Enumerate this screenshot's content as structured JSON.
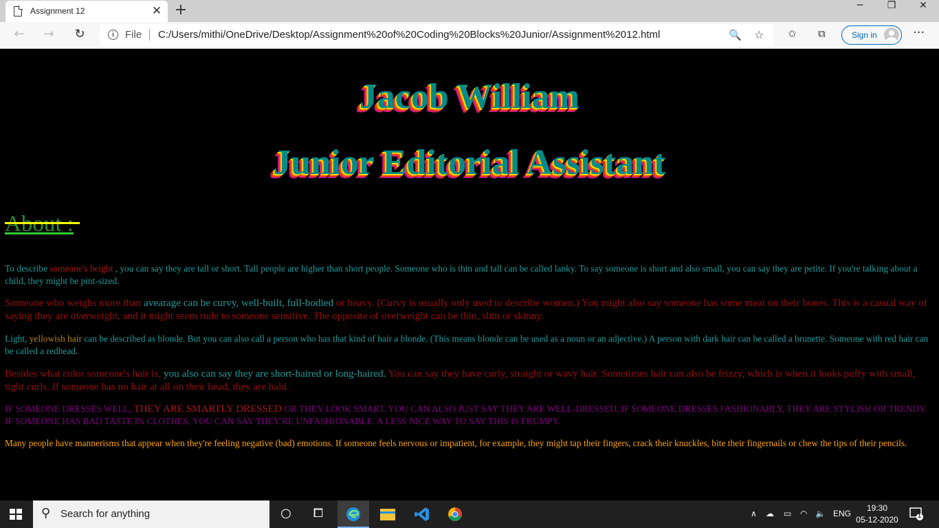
{
  "browser": {
    "tab_title": "Assignment 12",
    "tab_close": "✕",
    "new_tab": "+",
    "scheme_label": "File",
    "url": "C:/Users/mithi/OneDrive/Desktop/Assignment%20of%20Coding%20Blocks%20Junior/Assignment%2012.html",
    "sign_in": "Sign in",
    "more": "···"
  },
  "page": {
    "name_heading": "Jacob William",
    "role_heading": "Junior Editorial Assistant",
    "about_heading": "About :",
    "paragraphs": {
      "p1_a": "To describe ",
      "p1_hl": "someone's height",
      "p1_b": " , you can say they are tall or short. Tall people are higher than short people. Someone who is thin and tall can be called lanky. To say someone is short and also small, you can say they are petite. If you're talking about a child, they might be pint-sized.",
      "p2_a": "Someone who weighs more than ",
      "p2_hl": "avearage can be curvy, well-built, full-bodied",
      "p2_b": " or heavy. (Curvy is usually only used to describe women.) You might also say someone has some meat on their bones. This is a casual way of saying they are overweight, and it might seem rude to someone sensitive. The opposite of overweight can be thin, slim or skinny.",
      "p3_a": "Light, ",
      "p3_hl": "yellowish hair",
      "p3_b": " can be described as blonde. But you can also call a person who has that kind of hair a blonde. (This means blonde can be used as a noun or an adjective.) A person with dark hair can be called a brunette. Someone with red hair can be called a redhead.",
      "p4_a": "Besides what color someone's hair is, ",
      "p4_hl": "you also can say they are short-haired or long-haired.",
      "p4_b": " You can say they have curly, straight or wavy hair. Sometimes hair can also be frizzy, which is when it looks puffy with small, tight curls. If someone has no hair at all on their head, they are bald.",
      "p5_a": "IF SOMEONE DRESSES WELL, ",
      "p5_hl": "THEY ARE SMARTLY DRESSED",
      "p5_b": " OR THEY LOOK SMART. YOU CAN ALSO JUST SAY THEY ARE WELL-DRESSED. IF SOMEONE DRESSES FASHIONABLY, THEY ARE STYLISH OR TRENDY. IF SOMEONE HAS BAD TASTE IN CLOTHES, YOU CAN SAY THEY'RE UNFASHIONABLE. A LESS NICE WAY TO SAY THIS IS FRUMPY.",
      "p6": "Many people have mannerisms that appear when they're feeling negative (bad) emotions. If someone feels nervous or impatient, for example, they might tap their fingers, crack their knuckles, bite their fingernails or chew the tips of their pencils."
    }
  },
  "colors": {
    "page_bg": "#000000",
    "heading_fill": "#008b8b",
    "heading_shadows": [
      "#ffd700",
      "#ff4500",
      "#c71585"
    ],
    "about": "#2e8b2e",
    "teal_text": "#1f9b9b",
    "red_text": "#9b0d0d",
    "purple_text": "#800080",
    "orange_text": "#ffa500"
  },
  "taskbar": {
    "search_placeholder": "Search for anything",
    "language": "ENG",
    "time": "19:30",
    "date": "05-12-2020",
    "notification_count": "1"
  }
}
